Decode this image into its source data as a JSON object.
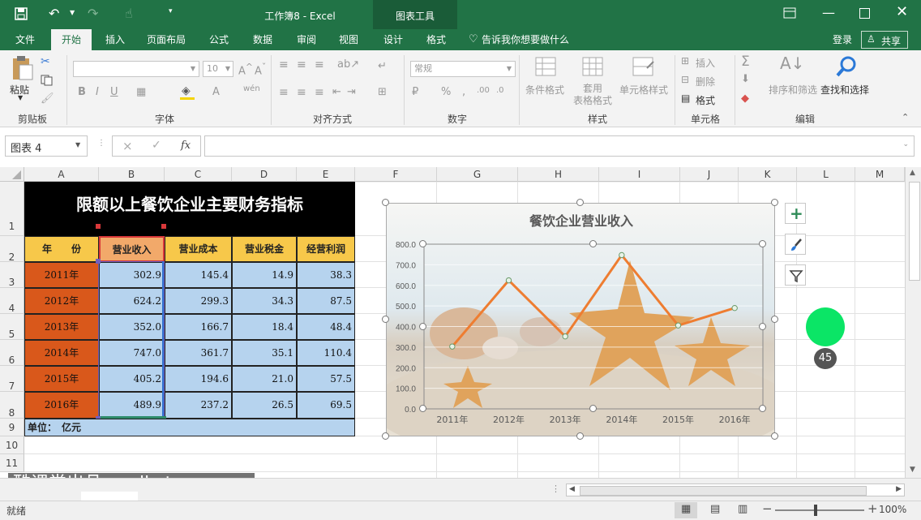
{
  "titlebar": {
    "title": "工作簿8 - Excel",
    "context_tab": "图表工具"
  },
  "menu": {
    "file": "文件",
    "home": "开始",
    "insert": "插入",
    "layout": "页面布局",
    "formulas": "公式",
    "data": "数据",
    "review": "审阅",
    "view": "视图",
    "design": "设计",
    "format": "格式",
    "tellme": "告诉我你想要做什么",
    "signin": "登录",
    "share": "共享"
  },
  "ribbon": {
    "paste": "粘贴",
    "clipboard": "剪贴板",
    "font_size": "10",
    "font": "字体",
    "alignment": "对齐方式",
    "number_format": "常规",
    "number": "数字",
    "conditional": "条件格式",
    "table_format": "套用\n表格格式",
    "cell_styles": "单元格样式",
    "styles": "样式",
    "insert": "插入",
    "delete": "删除",
    "format": "格式",
    "cells": "单元格",
    "sort_filter": "排序和筛选",
    "find_select": "查找和选择",
    "editing": "编辑"
  },
  "formulabar": {
    "name_box": "图表 4",
    "fx": "fx",
    "cancel": "×",
    "enter": "✓"
  },
  "columns": [
    "A",
    "B",
    "C",
    "D",
    "E",
    "F",
    "G",
    "H",
    "I",
    "J",
    "K",
    "L",
    "M"
  ],
  "rows": [
    "1",
    "2",
    "3",
    "4",
    "5",
    "6",
    "7",
    "8",
    "9",
    "10",
    "11"
  ],
  "table": {
    "title": "限额以上餐饮企业主要财务指标",
    "headers": [
      "年　　份",
      "营业收入",
      "营业成本",
      "营业税金",
      "经营利润"
    ],
    "rows": [
      [
        "2011年",
        "302.9",
        "145.4",
        "14.9",
        "38.3"
      ],
      [
        "2012年",
        "624.2",
        "299.3",
        "34.3",
        "87.5"
      ],
      [
        "2013年",
        "352.0",
        "166.7",
        "18.4",
        "48.4"
      ],
      [
        "2014年",
        "747.0",
        "361.7",
        "35.1",
        "110.4"
      ],
      [
        "2015年",
        "405.2",
        "194.6",
        "21.0",
        "57.5"
      ],
      [
        "2016年",
        "489.9",
        "237.2",
        "26.5",
        "69.5"
      ]
    ],
    "unit": "单位：　亿元"
  },
  "chart_data": {
    "type": "line",
    "title": "餐饮企业营业收入",
    "categories": [
      "2011年",
      "2012年",
      "2013年",
      "2014年",
      "2015年",
      "2016年"
    ],
    "values": [
      302.9,
      624.2,
      352.0,
      747.0,
      405.2,
      489.9
    ],
    "ylim": [
      0,
      800
    ],
    "yticks": [
      "0.0",
      "100.0",
      "200.0",
      "300.0",
      "400.0",
      "500.0",
      "600.0",
      "700.0",
      "800.0"
    ],
    "line_color": "#ee7d31",
    "grid": true,
    "legend": "none"
  },
  "cursor": {
    "badge": "45"
  },
  "watermark": "酷课堂出品 coolketang.com",
  "status": {
    "ready": "就绪",
    "zoom": "100%"
  }
}
